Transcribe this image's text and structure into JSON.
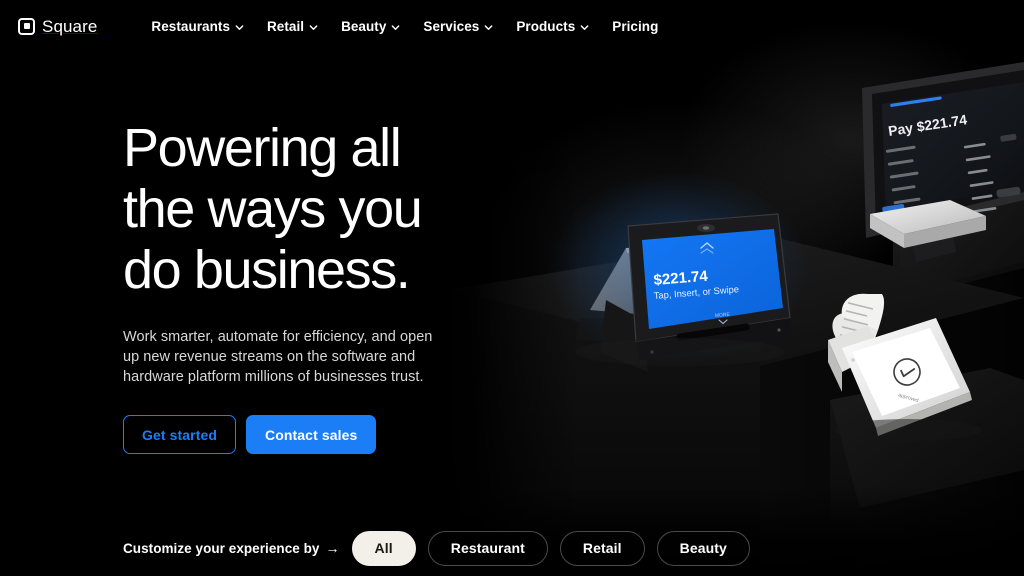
{
  "brand": {
    "name": "Square",
    "logo_icon": "square-logo-icon"
  },
  "nav": {
    "items": [
      {
        "label": "Restaurants",
        "has_caret": true,
        "icon": "chevron-down-icon"
      },
      {
        "label": "Retail",
        "has_caret": true,
        "icon": "chevron-down-icon"
      },
      {
        "label": "Beauty",
        "has_caret": true,
        "icon": "chevron-down-icon"
      },
      {
        "label": "Services",
        "has_caret": true,
        "icon": "chevron-down-icon"
      },
      {
        "label": "Products",
        "has_caret": true,
        "icon": "chevron-down-icon"
      },
      {
        "label": "Pricing",
        "has_caret": false,
        "icon": ""
      }
    ]
  },
  "hero": {
    "headline": "Powering all the ways you do business.",
    "subcopy": "Work smarter, automate for efficiency, and open up new revenue streams on the software and hardware platform millions of businesses trust.",
    "primary_cta": "Contact sales",
    "secondary_cta": "Get started"
  },
  "customize": {
    "label": "Customize your experience by",
    "arrow": "→",
    "pills": [
      {
        "label": "All",
        "active": true
      },
      {
        "label": "Restaurant",
        "active": false
      },
      {
        "label": "Retail",
        "active": false
      },
      {
        "label": "Beauty",
        "active": false
      }
    ]
  },
  "artwork": {
    "description": "Square hardware on dark plinths",
    "terminal_amount": "$221.74",
    "terminal_prompt": "Tap, Insert, or Swipe",
    "register_title": "Pay $221.74",
    "handheld_status_icon": "checkmark-circle-icon"
  },
  "colors": {
    "background": "#000000",
    "accent_blue": "#1C7EF7",
    "pill_active_bg": "#F3F0E9",
    "text_primary": "#FFFFFF",
    "text_secondary": "#D9D9D9"
  }
}
